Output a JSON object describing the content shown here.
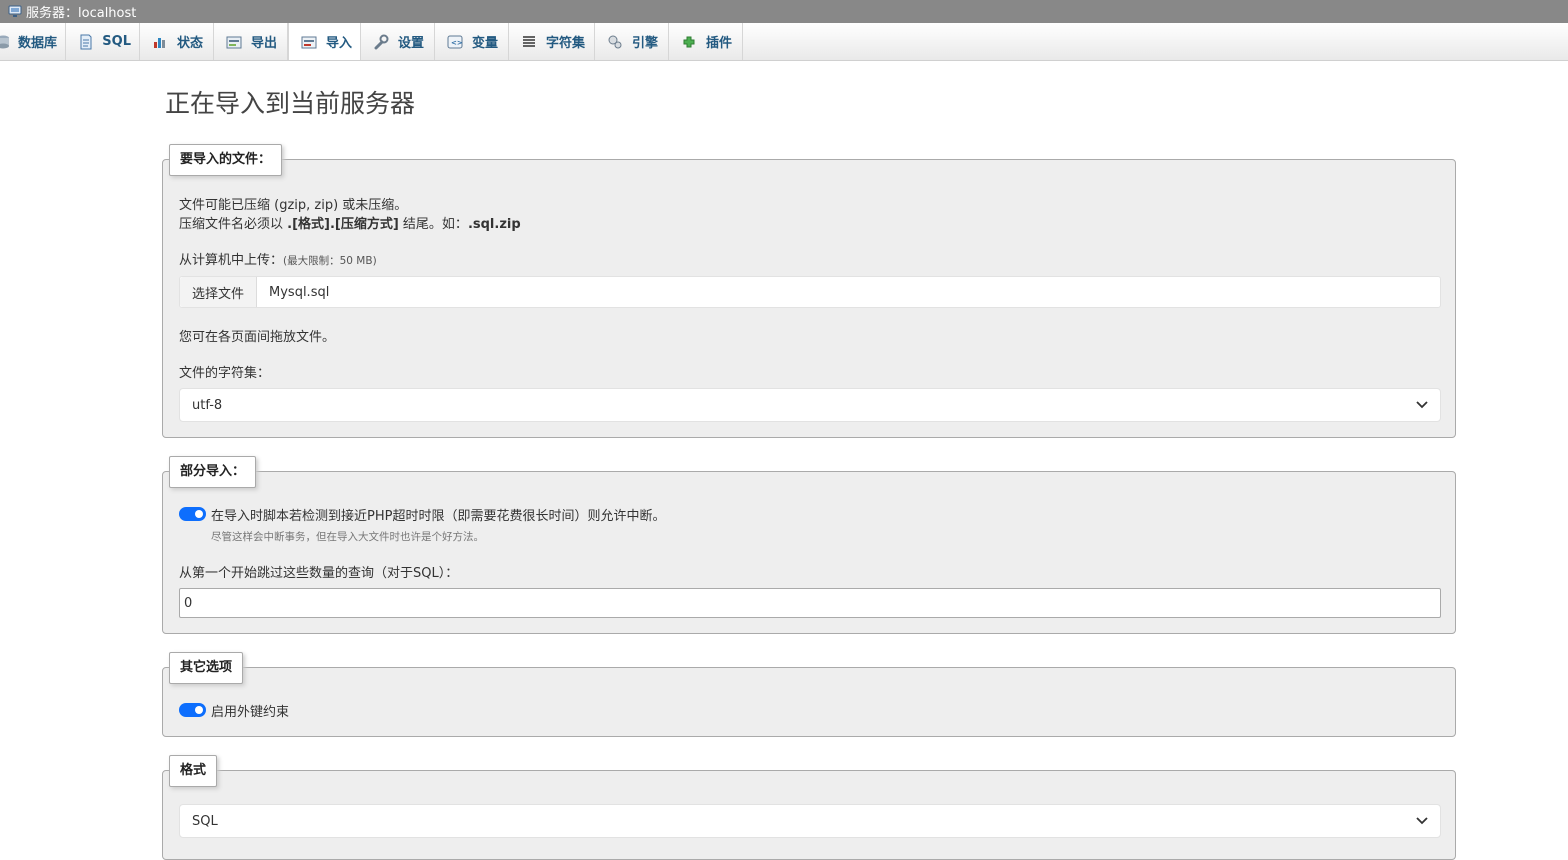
{
  "titlebar": {
    "label": "服务器：",
    "server": "localhost"
  },
  "tabs": [
    {
      "label": "数据库",
      "icon": "database-icon"
    },
    {
      "label": "SQL",
      "icon": "sql-icon"
    },
    {
      "label": "状态",
      "icon": "status-icon"
    },
    {
      "label": "导出",
      "icon": "export-icon"
    },
    {
      "label": "导入",
      "icon": "import-icon",
      "active": true
    },
    {
      "label": "设置",
      "icon": "wrench-icon"
    },
    {
      "label": "变量",
      "icon": "variables-icon"
    },
    {
      "label": "字符集",
      "icon": "charset-icon"
    },
    {
      "label": "引擎",
      "icon": "engine-icon"
    },
    {
      "label": "插件",
      "icon": "plugin-icon"
    }
  ],
  "page_title": "正在导入到当前服务器",
  "file_section": {
    "legend": "要导入的文件：",
    "desc1": "文件可能已压缩 (gzip, zip) 或未压缩。",
    "desc2_prefix": "压缩文件名必须以 ",
    "desc2_bold": ".[格式].[压缩方式]",
    "desc2_mid": " 结尾。如：",
    "desc2_example": ".sql.zip",
    "upload_label": "从计算机中上传：",
    "upload_limit": "(最大限制：50 MB)",
    "choose_button": "选择文件",
    "chosen_file": "Mysql.sql",
    "drag_hint": "您可在各页面间拖放文件。",
    "charset_label": "文件的字符集：",
    "charset_value": "utf-8"
  },
  "partial_section": {
    "legend": "部分导入：",
    "allow_interrupt_label": "在导入时脚本若检测到接近PHP超时时限（即需要花费很长时间）则允许中断。",
    "allow_interrupt_enabled": true,
    "allow_interrupt_hint": "尽管这样会中断事务，但在导入大文件时也许是个好方法。",
    "skip_label": "从第一个开始跳过这些数量的查询（对于SQL）：",
    "skip_value": "0"
  },
  "other_section": {
    "legend": "其它选项",
    "foreign_keys_label": "启用外键约束",
    "foreign_keys_enabled": true
  },
  "format_section": {
    "legend": "格式",
    "format_value": "SQL"
  },
  "colors": {
    "accent": "#0d6efd",
    "tab_text": "#235a81",
    "fieldset_bg": "#eeeeee",
    "titlebar_bg": "#888888"
  }
}
